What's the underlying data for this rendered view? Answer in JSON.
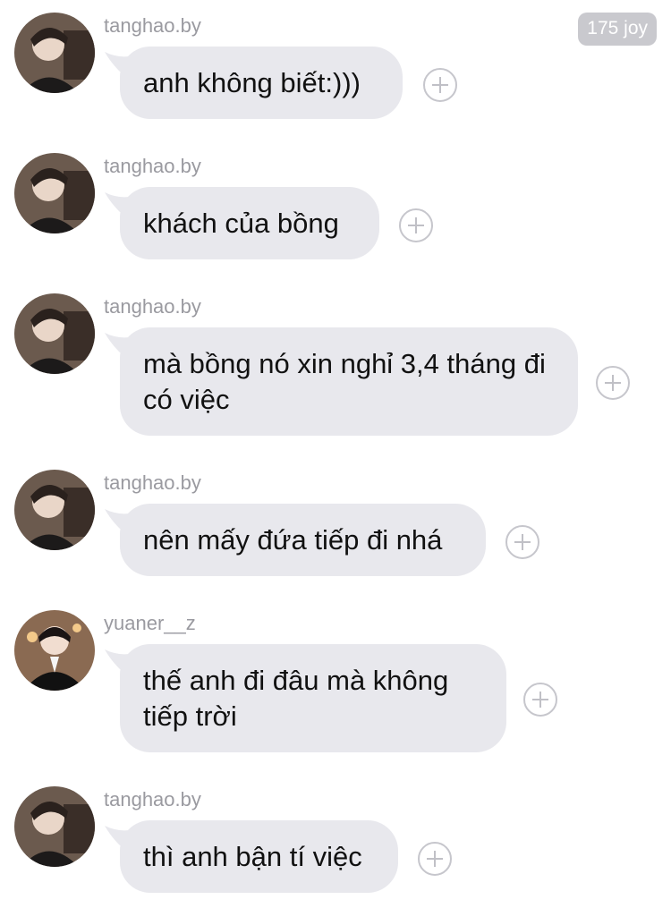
{
  "badge": {
    "label": "175 joy"
  },
  "messages": [
    {
      "username": "tanghao.by",
      "text": "anh không biết:)))",
      "avatar": "tanghao-avatar"
    },
    {
      "username": "tanghao.by",
      "text": "khách của bồng",
      "avatar": "tanghao-avatar"
    },
    {
      "username": "tanghao.by",
      "text": "mà bồng nó xin nghỉ 3,4 tháng đi có việc",
      "avatar": "tanghao-avatar"
    },
    {
      "username": "tanghao.by",
      "text": "nên mấy đứa tiếp đi nhá",
      "avatar": "tanghao-avatar"
    },
    {
      "username": "yuaner__z",
      "text": "thế anh đi đâu mà không tiếp trời",
      "avatar": "yuaner-avatar"
    },
    {
      "username": "tanghao.by",
      "text": "thì anh bận tí việc",
      "avatar": "tanghao-avatar"
    }
  ],
  "icons": {
    "add": "plus-circle-icon"
  },
  "colors": {
    "bubble": "#e8e8ed",
    "username": "#9a9aa0",
    "badge": "#c9c9ce"
  }
}
